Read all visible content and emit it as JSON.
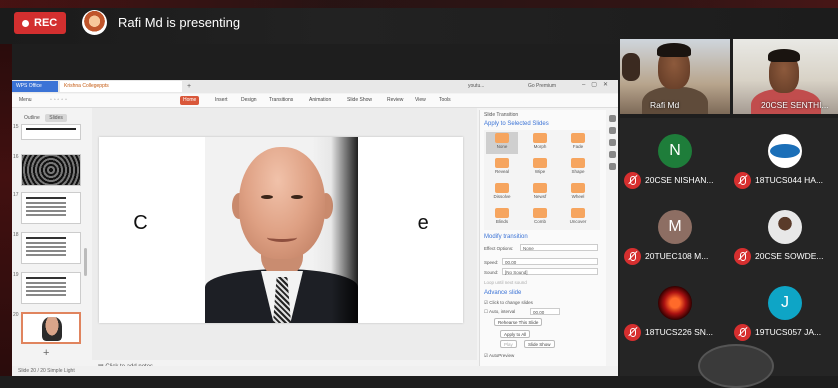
{
  "topbar": {
    "rec_label": "REC",
    "presenting_text": "Rafi Md is presenting"
  },
  "wps": {
    "tabs": {
      "app": "WPS Office",
      "document": "Krishna Collegeppts",
      "new_tab": "+",
      "youtube": "youtu...",
      "premium": "Go Premium"
    },
    "ribbon": {
      "menu": "Menu",
      "tabs": [
        "Home",
        "Insert",
        "Design",
        "Transitions",
        "Animation",
        "Slide Show",
        "Review",
        "View",
        "Tools"
      ],
      "active_tab": "Home"
    },
    "panel_tabs": [
      "Outline",
      "Slides"
    ],
    "thumbnails": [
      {
        "num": "15"
      },
      {
        "num": "16"
      },
      {
        "num": "17"
      },
      {
        "num": "18"
      },
      {
        "num": "19"
      },
      {
        "num": "20"
      }
    ],
    "slide": {
      "text_left": "C",
      "text_right": "e"
    },
    "notes_placeholder": "Click to add notes",
    "status": "Slide 20 / 20    Simple Light",
    "transition_panel": {
      "title": "Slide Transition",
      "apply_heading": "Apply to Selected Slides",
      "effects": [
        "None",
        "Morph",
        "Fade",
        "Reveal",
        "Wipe",
        "Shape",
        "Dissolve",
        "Newsf",
        "Wheel",
        "Blinds",
        "Comb",
        "Uncover"
      ],
      "selected_effect": "None",
      "modify_heading": "Modify transition",
      "effect_options_label": "Effect Options:",
      "effect_options_value": "None",
      "speed_label": "Speed:",
      "speed_value": "00.00",
      "sound_label": "Sound:",
      "sound_value": "[No Sound]",
      "loop_label": "Loop until next sound",
      "advance_heading": "Advance slide",
      "on_click_label": "Click to change slides",
      "auto_label": "Auto, interval",
      "auto_value": "00.00",
      "rehearse_button": "Rehearse This Slide",
      "apply_all_button": "Apply to All",
      "play_button": "Play",
      "slideshow_button": "Slide Show",
      "autopreview_label": "AutoPreview"
    }
  },
  "video_tiles": [
    {
      "name": "Rafi Md"
    },
    {
      "name": "20CSE SENTHI..."
    }
  ],
  "participants": [
    {
      "initial": "N",
      "name": "20CSE NISHAN...",
      "color": "#1e7d3a"
    },
    {
      "initial": "",
      "name": "18TUCS044 HA...",
      "color": "#ffffff"
    },
    {
      "initial": "M",
      "name": "20TUEC108 M...",
      "color": "#8d6e63"
    },
    {
      "initial": "",
      "name": "20CSE SOWDE...",
      "color": "#e0e0e0"
    },
    {
      "initial": "",
      "name": "18TUCS226 SN...",
      "color": "#b71c1c"
    },
    {
      "initial": "J",
      "name": "19TUCS057 JA...",
      "color": "#0ea5c6"
    }
  ]
}
